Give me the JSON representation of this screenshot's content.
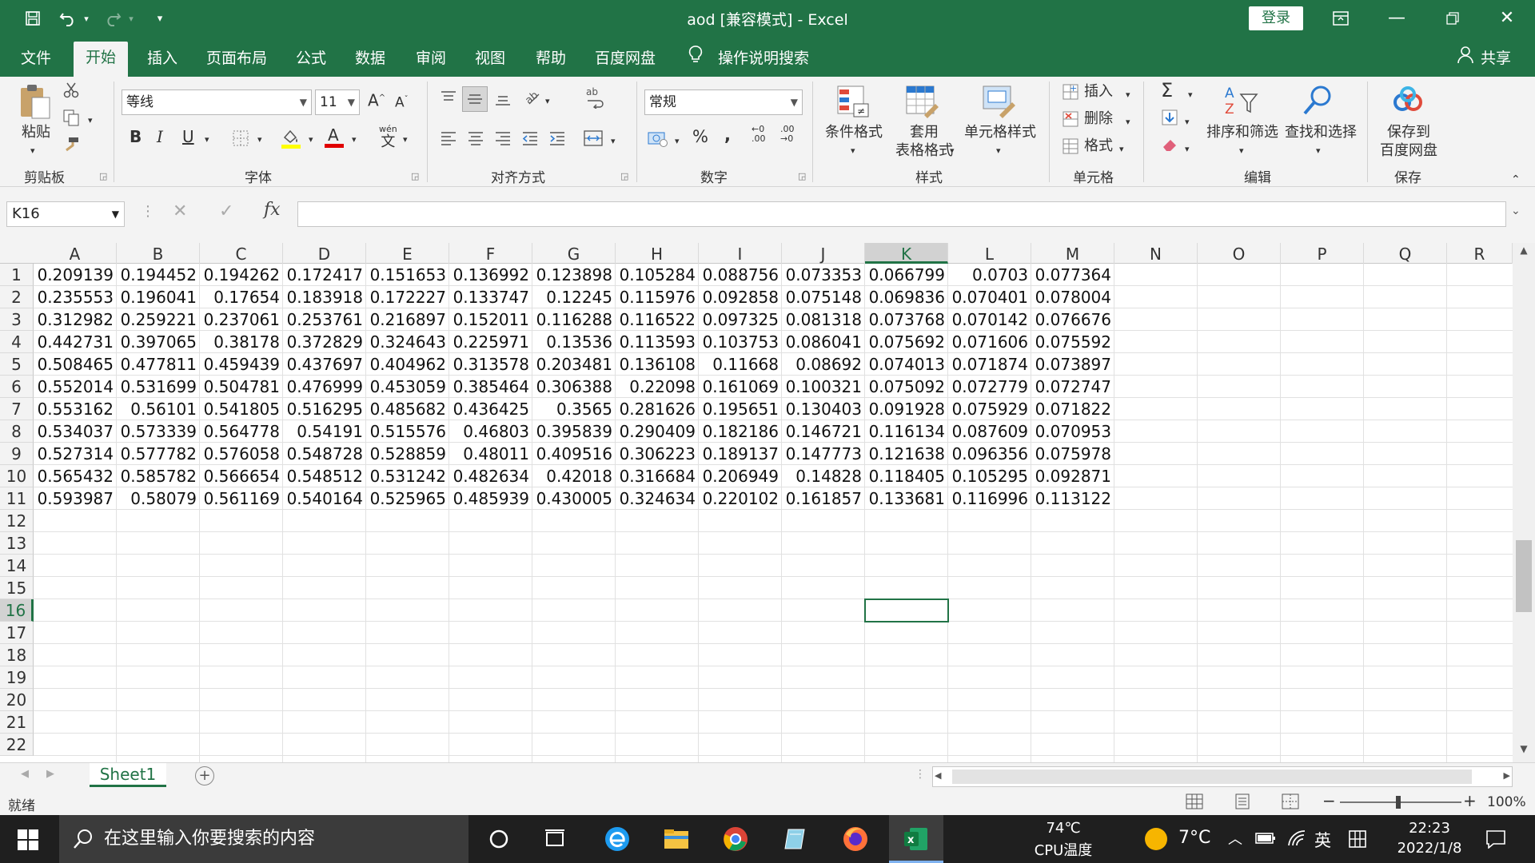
{
  "window": {
    "title": "aod  [兼容模式]  -  Excel",
    "login": "登录"
  },
  "menu": [
    {
      "label": "文件"
    },
    {
      "label": "开始"
    },
    {
      "label": "插入"
    },
    {
      "label": "页面布局"
    },
    {
      "label": "公式"
    },
    {
      "label": "数据"
    },
    {
      "label": "审阅"
    },
    {
      "label": "视图"
    },
    {
      "label": "帮助"
    },
    {
      "label": "百度网盘"
    },
    {
      "label": "操作说明搜索"
    }
  ],
  "share": "共享",
  "ribbon": {
    "clipboard": {
      "label": "剪贴板",
      "paste": "粘贴"
    },
    "font": {
      "label": "字体",
      "family": "等线",
      "size": "11",
      "wen": "wén",
      "wen2": "文"
    },
    "alignment": {
      "label": "对齐方式"
    },
    "number": {
      "label": "数字",
      "format": "常规",
      "inc_top": "←0",
      "inc_bot": ".00",
      "dec_top": ".00",
      "dec_bot": "→0"
    },
    "styles": {
      "label": "样式",
      "conditional": "条件格式",
      "table1": "套用",
      "table2": "表格格式",
      "cell_styles": "单元格样式"
    },
    "cells": {
      "label": "单元格",
      "insert": "插入",
      "delete": "删除",
      "format": "格式"
    },
    "editing": {
      "label": "编辑",
      "sort": "排序和筛选",
      "find": "查找和选择"
    },
    "save": {
      "label": "保存",
      "line1": "保存到",
      "line2": "百度网盘"
    }
  },
  "name_box": "K16",
  "formula": "",
  "columns": [
    "A",
    "B",
    "C",
    "D",
    "E",
    "F",
    "G",
    "H",
    "I",
    "J",
    "K",
    "L",
    "M",
    "N",
    "O",
    "P",
    "Q",
    "R"
  ],
  "rows": [
    "1",
    "2",
    "3",
    "4",
    "5",
    "6",
    "7",
    "8",
    "9",
    "10",
    "11",
    "12",
    "13",
    "14",
    "15",
    "16",
    "17",
    "18",
    "19",
    "20",
    "21",
    "22"
  ],
  "cells": [
    [
      "0.209139",
      "0.194452",
      "0.194262",
      "0.172417",
      "0.151653",
      "0.136992",
      "0.123898",
      "0.105284",
      "0.088756",
      "0.073353",
      "0.066799",
      "0.0703",
      "0.077364"
    ],
    [
      "0.235553",
      "0.196041",
      "0.17654",
      "0.183918",
      "0.172227",
      "0.133747",
      "0.12245",
      "0.115976",
      "0.092858",
      "0.075148",
      "0.069836",
      "0.070401",
      "0.078004"
    ],
    [
      "0.312982",
      "0.259221",
      "0.237061",
      "0.253761",
      "0.216897",
      "0.152011",
      "0.116288",
      "0.116522",
      "0.097325",
      "0.081318",
      "0.073768",
      "0.070142",
      "0.076676"
    ],
    [
      "0.442731",
      "0.397065",
      "0.38178",
      "0.372829",
      "0.324643",
      "0.225971",
      "0.13536",
      "0.113593",
      "0.103753",
      "0.086041",
      "0.075692",
      "0.071606",
      "0.075592"
    ],
    [
      "0.508465",
      "0.477811",
      "0.459439",
      "0.437697",
      "0.404962",
      "0.313578",
      "0.203481",
      "0.136108",
      "0.11668",
      "0.08692",
      "0.074013",
      "0.071874",
      "0.073897"
    ],
    [
      "0.552014",
      "0.531699",
      "0.504781",
      "0.476999",
      "0.453059",
      "0.385464",
      "0.306388",
      "0.22098",
      "0.161069",
      "0.100321",
      "0.075092",
      "0.072779",
      "0.072747"
    ],
    [
      "0.553162",
      "0.56101",
      "0.541805",
      "0.516295",
      "0.485682",
      "0.436425",
      "0.3565",
      "0.281626",
      "0.195651",
      "0.130403",
      "0.091928",
      "0.075929",
      "0.071822"
    ],
    [
      "0.534037",
      "0.573339",
      "0.564778",
      "0.54191",
      "0.515576",
      "0.46803",
      "0.395839",
      "0.290409",
      "0.182186",
      "0.146721",
      "0.116134",
      "0.087609",
      "0.070953"
    ],
    [
      "0.527314",
      "0.577782",
      "0.576058",
      "0.548728",
      "0.528859",
      "0.48011",
      "0.409516",
      "0.306223",
      "0.189137",
      "0.147773",
      "0.121638",
      "0.096356",
      "0.075978"
    ],
    [
      "0.565432",
      "0.585782",
      "0.566654",
      "0.548512",
      "0.531242",
      "0.482634",
      "0.42018",
      "0.316684",
      "0.206949",
      "0.14828",
      "0.118405",
      "0.105295",
      "0.092871"
    ],
    [
      "0.593987",
      "0.58079",
      "0.561169",
      "0.540164",
      "0.525965",
      "0.485939",
      "0.430005",
      "0.324634",
      "0.220102",
      "0.161857",
      "0.133681",
      "0.116996",
      "0.113122"
    ]
  ],
  "sheet_tab": "Sheet1",
  "status": {
    "ready": "就绪",
    "zoom": "100%"
  },
  "taskbar": {
    "search": "在这里输入你要搜索的内容",
    "cpu_temp": "74℃",
    "cpu_label": "CPU温度",
    "weather": "7°C",
    "ime": "英",
    "time": "22:23",
    "date": "2022/1/8"
  },
  "colors": {
    "excel_green": "#217346",
    "taskbar": "#1f1f1f"
  }
}
